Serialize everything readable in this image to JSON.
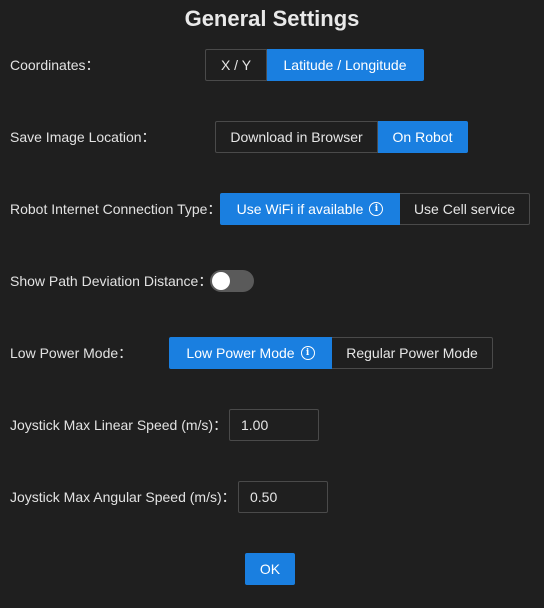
{
  "dialog": {
    "title": "General Settings",
    "ok_label": "OK"
  },
  "coordinates": {
    "label": "Coordinates：",
    "options": [
      "X / Y",
      "Latitude / Longitude"
    ],
    "selected": "Latitude / Longitude"
  },
  "save_image_location": {
    "label": "Save Image Location：",
    "options": [
      "Download in Browser",
      "On Robot"
    ],
    "selected": "On Robot"
  },
  "internet_connection": {
    "label": "Robot Internet Connection Type：",
    "options": [
      "Use WiFi if available",
      "Use Cell service"
    ],
    "selected": "Use WiFi if available"
  },
  "path_deviation": {
    "label": "Show Path Deviation Distance：",
    "enabled": false
  },
  "low_power_mode": {
    "label": "Low Power Mode：",
    "options": [
      "Low Power Mode",
      "Regular Power Mode"
    ],
    "selected": "Low Power Mode"
  },
  "joystick_linear": {
    "label": "Joystick Max Linear Speed (m/s)：",
    "value": "1.00"
  },
  "joystick_angular": {
    "label": "Joystick Max Angular Speed (m/s)：",
    "value": "0.50"
  },
  "colors": {
    "accent": "#1a7fe0",
    "background": "#1f1f1f",
    "toggle_off": "#5a5a5a"
  },
  "icons": {
    "info": "info-circle-icon"
  }
}
